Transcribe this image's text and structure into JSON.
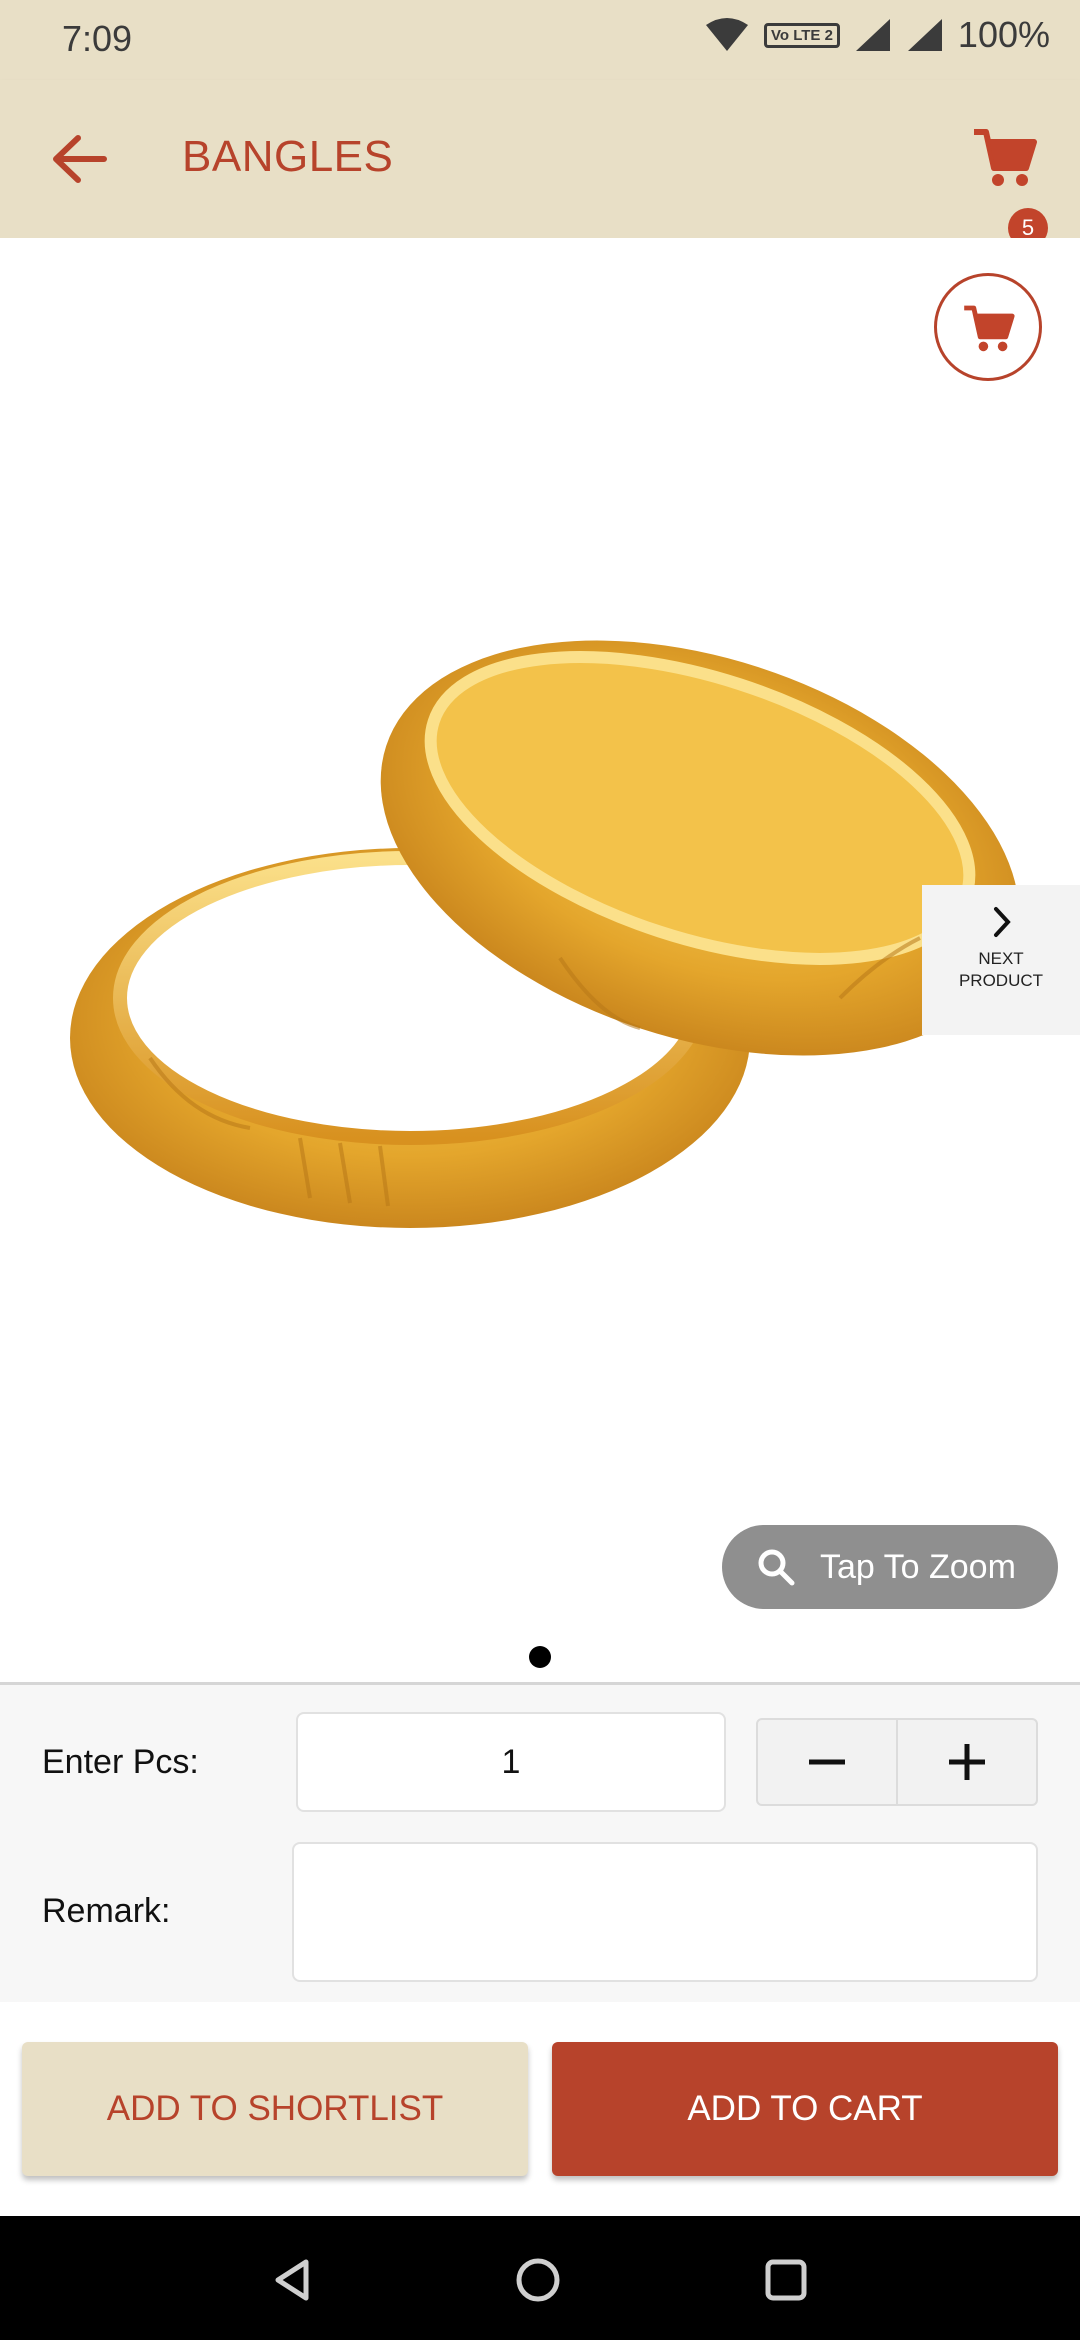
{
  "status_bar": {
    "time": "7:09",
    "network_label": "Vo LTE 2",
    "battery": "100%"
  },
  "app_bar": {
    "title": "BANGLES",
    "cart_badge": "5"
  },
  "product": {
    "image_alt": "BANGLES",
    "next_label": "NEXT PRODUCT",
    "zoom_label": "Tap To Zoom"
  },
  "form": {
    "pcs_label": "Enter Pcs:",
    "pcs_value": "1",
    "remark_label": "Remark:",
    "remark_value": ""
  },
  "actions": {
    "shortlist": "ADD TO SHORTLIST",
    "add_to_cart": "ADD TO CART"
  },
  "colors": {
    "accent": "#b7432b",
    "header_bg": "#e8dfc6",
    "gold": "#e0a22a"
  },
  "icons": [
    "wifi-icon",
    "signal-icon",
    "back-arrow-icon",
    "cart-icon",
    "chevron-right-icon",
    "search-icon",
    "minus-icon",
    "plus-icon",
    "nav-back-icon",
    "nav-home-icon",
    "nav-recents-icon"
  ]
}
